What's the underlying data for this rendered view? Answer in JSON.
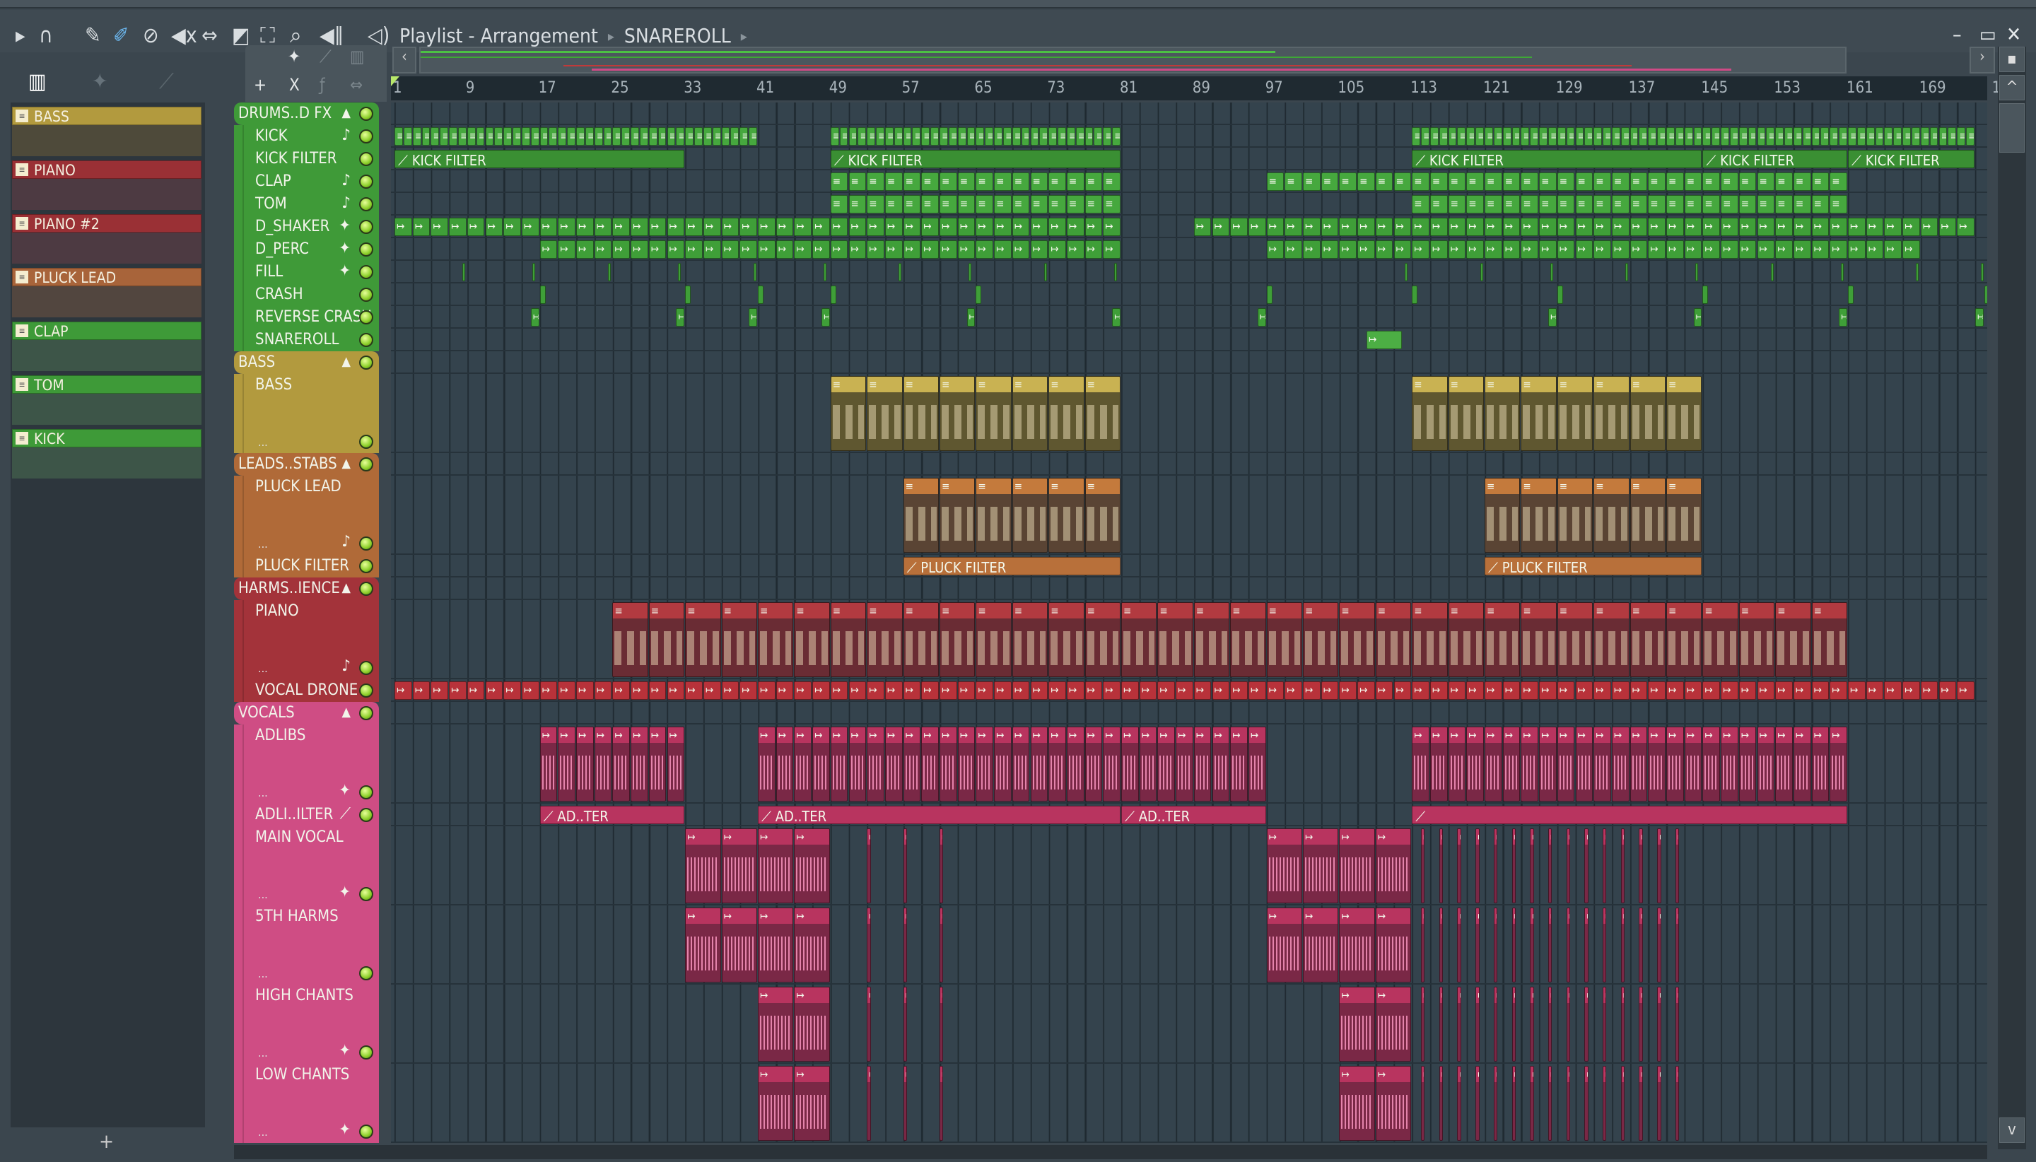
{
  "titlebar": {
    "title": "Playlist - Arrangement",
    "pattern": "SNAREROLL",
    "icons": [
      "play-arrow-icon",
      "magnet-icon",
      "pencil-icon",
      "paint-brush-icon",
      "delete-icon",
      "mute-icon",
      "slip-icon",
      "slice-icon",
      "select-icon",
      "zoom-icon",
      "playback-icon",
      "speaker-icon"
    ]
  },
  "window": {
    "minimize": "–",
    "maximize": "▭",
    "close": "✕"
  },
  "picker": {
    "items": [
      {
        "name": "BASS",
        "color": "#b29a3e",
        "body": "#4e4a3a"
      },
      {
        "name": "PIANO",
        "color": "#9a3035",
        "body": "#4d3a42"
      },
      {
        "name": "PIANO #2",
        "color": "#9a3035",
        "body": "#4d3a42"
      },
      {
        "name": "PLUCK LEAD",
        "color": "#a8643a",
        "body": "#52463f"
      },
      {
        "name": "CLAP",
        "color": "#3e9a38",
        "body": "#3d5548"
      },
      {
        "name": "TOM",
        "color": "#3e9a38",
        "body": "#3d5548"
      },
      {
        "name": "KICK",
        "color": "#3e9a38",
        "body": "#3d5548"
      }
    ]
  },
  "ruler": {
    "bars": [
      "1",
      "9",
      "17",
      "25",
      "33",
      "41",
      "49",
      "57",
      "65",
      "73",
      "81",
      "89",
      "97",
      "105",
      "113",
      "121",
      "129",
      "137",
      "145",
      "153",
      "161",
      "169",
      "17"
    ]
  },
  "tracks": [
    {
      "name": "DRUMS..D FX",
      "group": true,
      "color": "#3f9a38"
    },
    {
      "name": "KICK",
      "icon": "note",
      "color": "#3f9a38",
      "clipColor": "#46a83e",
      "runs": [
        [
          1,
          41,
          1
        ],
        [
          49,
          81,
          1
        ],
        [
          113,
          175,
          1
        ]
      ]
    },
    {
      "name": "KICK FILTER",
      "color": "#3f9a38",
      "clipColor": "#3a8f33",
      "clips": [
        [
          1,
          33,
          "KICK FILTER"
        ],
        [
          49,
          81,
          "KICK FILTER"
        ],
        [
          113,
          145,
          "KICK FILTER"
        ],
        [
          145,
          161,
          "KICK FILTER"
        ],
        [
          161,
          175,
          "KICK FILTER"
        ]
      ]
    },
    {
      "name": "CLAP",
      "icon": "note",
      "color": "#3f9a38",
      "clipColor": "#46a83e",
      "runs": [
        [
          49,
          81,
          2
        ],
        [
          97,
          161,
          2
        ]
      ]
    },
    {
      "name": "TOM",
      "icon": "note",
      "color": "#3f9a38",
      "clipColor": "#46a83e",
      "runs": [
        [
          49,
          81,
          2
        ],
        [
          113,
          161,
          2
        ]
      ]
    },
    {
      "name": "D_SHAKER",
      "icon": "wave",
      "color": "#3f9a38",
      "clipColor": "#3f9f38",
      "runs": [
        [
          1,
          81,
          2
        ],
        [
          89,
          175,
          2
        ]
      ]
    },
    {
      "name": "D_PERC",
      "icon": "wave",
      "color": "#3f9a38",
      "clipColor": "#3f9f38",
      "runs": [
        [
          17,
          81,
          2
        ],
        [
          97,
          169,
          2
        ]
      ]
    },
    {
      "name": "FILL",
      "icon": "wave",
      "color": "#3f9a38",
      "clipColor": "#3f9f38",
      "clips": [
        [
          8.5,
          8.8
        ],
        [
          16.2,
          16.6
        ],
        [
          24.5,
          24.8
        ],
        [
          32.2,
          32.6
        ],
        [
          40.5,
          40.8
        ],
        [
          48.2,
          48.6
        ],
        [
          56.5,
          56.8
        ],
        [
          64.2,
          64.6
        ],
        [
          72.5,
          72.8
        ],
        [
          80.2,
          80.6
        ],
        [
          112.2,
          112.6
        ],
        [
          120.5,
          120.8
        ],
        [
          128.2,
          128.6
        ],
        [
          136.5,
          136.8
        ],
        [
          144.2,
          144.6
        ],
        [
          152.5,
          152.8
        ],
        [
          160.2,
          160.6
        ],
        [
          168.5,
          168.8
        ],
        [
          175.6,
          176
        ]
      ]
    },
    {
      "name": "CRASH",
      "color": "#3f9a38",
      "clipColor": "#3f9f38",
      "clips": [
        [
          17,
          17.7
        ],
        [
          33,
          33.7
        ],
        [
          41,
          41.7
        ],
        [
          49,
          49.7
        ],
        [
          65,
          65.7
        ],
        [
          97,
          97.7
        ],
        [
          113,
          113.7
        ],
        [
          129,
          129.7
        ],
        [
          145,
          145.7
        ],
        [
          161,
          161.7
        ],
        [
          176,
          176.7
        ]
      ]
    },
    {
      "name": "REVERSE CRASH",
      "color": "#3f9a38",
      "clipColor": "#3f9f38",
      "clips": [
        [
          16,
          17
        ],
        [
          32,
          33
        ],
        [
          40,
          41
        ],
        [
          48,
          49
        ],
        [
          64,
          65
        ],
        [
          80,
          81
        ],
        [
          96,
          97
        ],
        [
          128,
          129
        ],
        [
          144,
          145
        ],
        [
          160,
          161
        ],
        [
          175,
          176
        ]
      ]
    },
    {
      "name": "SNAREROLL",
      "color": "#3f9a38",
      "clipColor": "#4cae44",
      "clips": [
        [
          108,
          112
        ]
      ]
    },
    {
      "name": "BASS",
      "group": true,
      "color": "#b29a3e"
    },
    {
      "name": "BASS",
      "icon": "",
      "color": "#b29a3e",
      "clipColor": "#c9b252",
      "body": "#5f5730",
      "runs": [
        [
          49,
          81,
          4
        ],
        [
          113,
          145,
          4
        ]
      ]
    },
    {
      "name": "LEADS..STABS",
      "group": true,
      "color": "#b06a38"
    },
    {
      "name": "PLUCK LEAD",
      "icon": "note",
      "color": "#b06a38",
      "clipColor": "#c47a3c",
      "body": "#5a4434",
      "runs": [
        [
          57,
          81,
          4
        ],
        [
          121,
          145,
          4
        ]
      ]
    },
    {
      "name": "PLUCK FILTER",
      "color": "#b06a38",
      "clipColor": "#b8703a",
      "clips": [
        [
          57,
          81,
          "PLUCK FILTER"
        ],
        [
          121,
          145,
          "PLUCK FILTER"
        ]
      ]
    },
    {
      "name": "HARMS..IENCE",
      "group": true,
      "color": "#a3333a"
    },
    {
      "name": "PIANO",
      "icon": "note",
      "color": "#a3333a",
      "clipColor": "#b23a40",
      "body": "#6a2c34",
      "runs": [
        [
          25,
          161,
          4
        ]
      ]
    },
    {
      "name": "VOCAL DRONE",
      "color": "#a3333a",
      "clipColor": "#b8323a",
      "runs": [
        [
          1,
          175,
          2
        ]
      ]
    },
    {
      "name": "VOCALS",
      "group": true,
      "color": "#cf4d84"
    },
    {
      "name": "ADLIBS",
      "icon": "wave",
      "color": "#cf4d84",
      "clipColor": "#b8345f",
      "body": "#7a2846",
      "runs": [
        [
          17,
          33,
          2
        ],
        [
          41,
          97,
          2
        ],
        [
          113,
          161,
          2
        ]
      ]
    },
    {
      "name": "ADLI..ILTER",
      "icon": "auto",
      "color": "#cf4d84",
      "clipColor": "#b8345f",
      "clips": [
        [
          17,
          33,
          "AD..TER"
        ],
        [
          41,
          81,
          "AD..TER"
        ],
        [
          81,
          97,
          "AD..TER"
        ],
        [
          113,
          161,
          ""
        ]
      ]
    },
    {
      "name": "MAIN VOCAL",
      "icon": "wave",
      "color": "#cf4d84",
      "clipColor": "#b8345f",
      "body": "#7a2846",
      "runs": [
        [
          33,
          49,
          4
        ],
        [
          97,
          113,
          4
        ]
      ],
      "clips": [
        [
          53,
          53.5
        ],
        [
          57,
          57.5
        ],
        [
          61,
          61.5
        ],
        [
          114,
          114.5
        ],
        [
          116,
          116.5
        ],
        [
          118,
          118.5
        ],
        [
          120,
          120.5
        ],
        [
          122,
          122.5
        ],
        [
          124,
          124.5
        ],
        [
          126,
          126.5
        ],
        [
          128,
          128.5
        ],
        [
          130,
          130.5
        ],
        [
          132,
          132.5
        ],
        [
          134,
          134.5
        ],
        [
          136,
          136.5
        ],
        [
          138,
          138.5
        ],
        [
          140,
          140.5
        ],
        [
          142,
          142.5
        ]
      ]
    },
    {
      "name": "5TH HARMS",
      "icon": "",
      "color": "#cf4d84",
      "clipColor": "#b8345f",
      "body": "#7a2846",
      "runs": [
        [
          33,
          49,
          4
        ],
        [
          97,
          113,
          4
        ]
      ],
      "clips": [
        [
          53,
          53.5
        ],
        [
          57,
          57.5
        ],
        [
          61,
          61.5
        ],
        [
          114,
          114.5
        ],
        [
          116,
          116.5
        ],
        [
          118,
          118.5
        ],
        [
          120,
          120.5
        ],
        [
          122,
          122.5
        ],
        [
          124,
          124.5
        ],
        [
          126,
          126.5
        ],
        [
          128,
          128.5
        ],
        [
          130,
          130.5
        ],
        [
          132,
          132.5
        ],
        [
          134,
          134.5
        ],
        [
          136,
          136.5
        ],
        [
          138,
          138.5
        ],
        [
          140,
          140.5
        ],
        [
          142,
          142.5
        ]
      ]
    },
    {
      "name": "HIGH CHANTS",
      "icon": "wave",
      "color": "#cf4d84",
      "clipColor": "#b8345f",
      "body": "#7a2846",
      "runs": [
        [
          41,
          49,
          4
        ],
        [
          105,
          113,
          4
        ]
      ],
      "clips": [
        [
          53,
          53.5
        ],
        [
          57,
          57.5
        ],
        [
          61,
          61.5
        ],
        [
          114,
          114.5
        ],
        [
          116,
          116.5
        ],
        [
          118,
          118.5
        ],
        [
          120,
          120.5
        ],
        [
          122,
          122.5
        ],
        [
          124,
          124.5
        ],
        [
          126,
          126.5
        ],
        [
          128,
          128.5
        ],
        [
          130,
          130.5
        ],
        [
          132,
          132.5
        ],
        [
          134,
          134.5
        ],
        [
          136,
          136.5
        ],
        [
          138,
          138.5
        ],
        [
          140,
          140.5
        ],
        [
          142,
          142.5
        ]
      ]
    },
    {
      "name": "LOW CHANTS",
      "icon": "wave",
      "color": "#cf4d84",
      "clipColor": "#b8345f",
      "body": "#7a2846",
      "runs": [
        [
          41,
          49,
          4
        ],
        [
          105,
          113,
          4
        ]
      ],
      "clips": [
        [
          53,
          53.5
        ],
        [
          57,
          57.5
        ],
        [
          61,
          61.5
        ],
        [
          114,
          114.5
        ],
        [
          116,
          116.5
        ],
        [
          118,
          118.5
        ],
        [
          120,
          120.5
        ],
        [
          122,
          122.5
        ],
        [
          124,
          124.5
        ],
        [
          126,
          126.5
        ],
        [
          128,
          128.5
        ],
        [
          130,
          130.5
        ],
        [
          132,
          132.5
        ],
        [
          134,
          134.5
        ],
        [
          136,
          136.5
        ],
        [
          138,
          138.5
        ],
        [
          140,
          140.5
        ],
        [
          142,
          142.5
        ]
      ]
    }
  ]
}
